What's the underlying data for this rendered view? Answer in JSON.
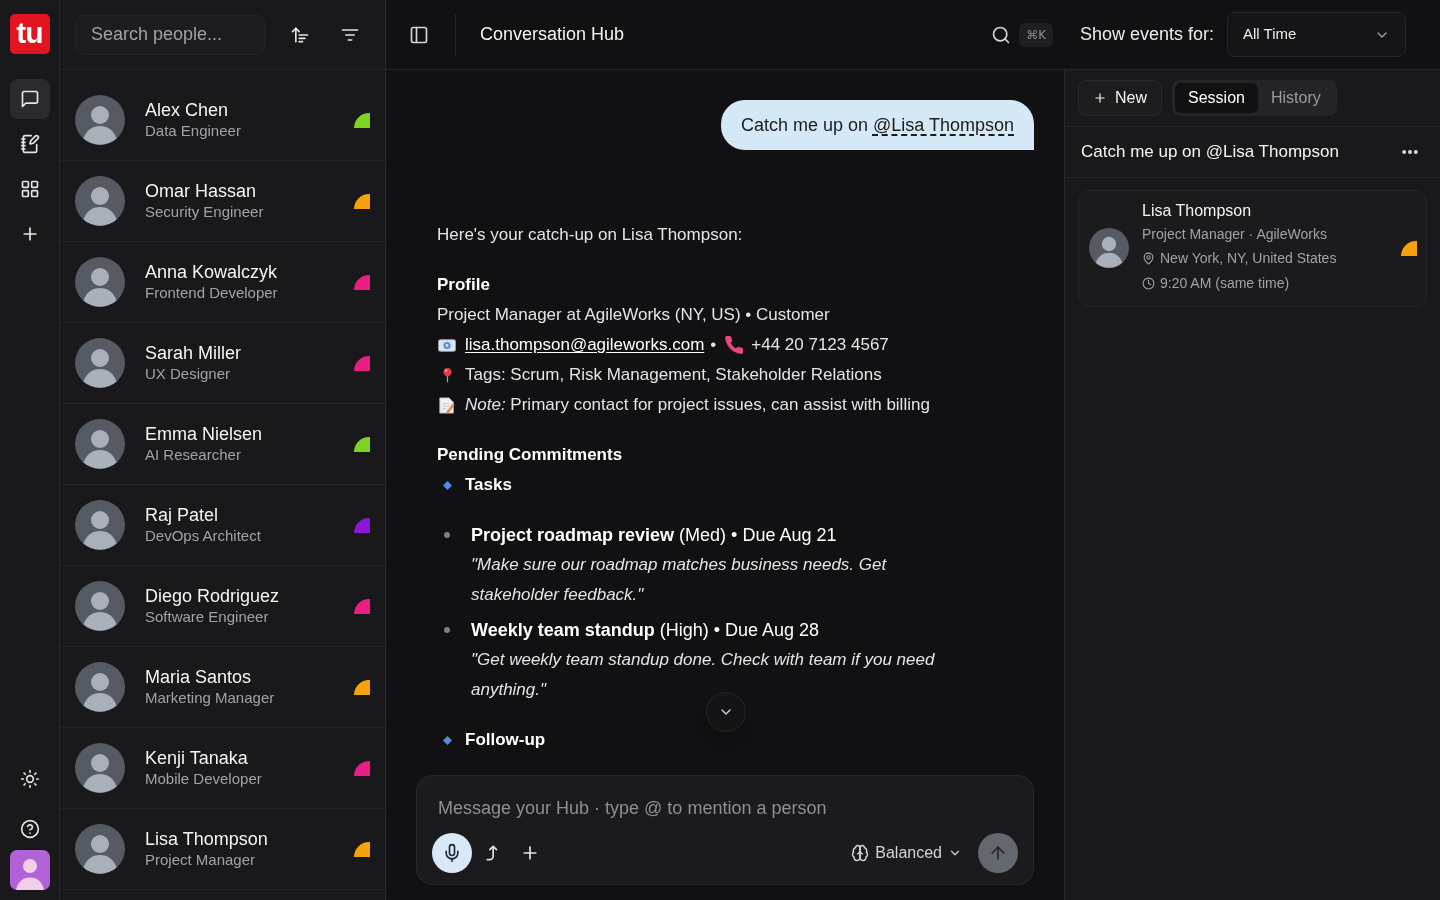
{
  "rail": {
    "logo": "tu",
    "nav": [
      {
        "kind": "chat",
        "selected": true
      },
      {
        "kind": "notes",
        "selected": false
      },
      {
        "kind": "apps",
        "selected": false
      },
      {
        "kind": "add",
        "selected": false
      }
    ]
  },
  "contacts": {
    "search": {
      "placeholder": "Search people..."
    },
    "people": [
      {
        "name": "Alex Chen",
        "role": "Data Engineer",
        "color": "#7dd31f"
      },
      {
        "name": "Omar Hassan",
        "role": "Security Engineer",
        "color": "#f7a10b"
      },
      {
        "name": "Anna Kowalczyk",
        "role": "Frontend Developer",
        "color": "#ea1d84"
      },
      {
        "name": "Sarah Miller",
        "role": "UX Designer",
        "color": "#ea1d84"
      },
      {
        "name": "Emma Nielsen",
        "role": "AI Researcher",
        "color": "#7dd31f"
      },
      {
        "name": "Raj Patel",
        "role": "DevOps Architect",
        "color": "#8a17d9"
      },
      {
        "name": "Diego Rodriguez",
        "role": "Software Engineer",
        "color": "#ea1d84"
      },
      {
        "name": "Maria Santos",
        "role": "Marketing Manager",
        "color": "#f7a10b"
      },
      {
        "name": "Kenji Tanaka",
        "role": "Mobile Developer",
        "color": "#ea1d84"
      },
      {
        "name": "Lisa Thompson",
        "role": "Project Manager",
        "color": "#f7a10b"
      }
    ]
  },
  "header": {
    "title": "Conversation Hub",
    "shortcut": "⌘K",
    "events_label": "Show events for:",
    "events_filter": "All Time"
  },
  "chat": {
    "user_message": {
      "text": "Catch me up on",
      "mention": "@Lisa Thompson"
    },
    "reply": {
      "intro": "Here's your catch-up on Lisa Thompson:",
      "profile": {
        "heading": "Profile",
        "summary": "Project Manager at AgileWorks (NY, US) • Customer",
        "email": "lisa.thompson@agileworks.com",
        "separator": "•",
        "phone": "+44 20 7123 4567",
        "tags": "Tags: Scrum, Risk Management, Stakeholder Relations",
        "note": "*Note:* Primary contact for project issues, can assist with billing"
      },
      "commitments": {
        "heading": "Pending Commitments",
        "groups": [
          {
            "title": "Tasks",
            "items": [
              {
                "title": "**Project roadmap review** (Med) • Due Aug 21",
                "quote": "\"Make sure our roadmap matches business needs. Get stakeholder feedback.\""
              },
              {
                "title": "**Weekly team standup** (High) • Due Aug 28",
                "quote": "\"Get weekly team standup done. Check with team if you need anything.\""
              }
            ]
          },
          {
            "title": "Follow-up"
          }
        ]
      }
    }
  },
  "composer": {
    "placeholder": "Message your Hub · type @ to mention a person",
    "mode": "Balanced"
  },
  "session_panel": {
    "new_button": "New",
    "tabs": [
      {
        "label": "Session",
        "selected": true
      },
      {
        "label": "History",
        "selected": false
      }
    ],
    "session_title": "Catch me up on @Lisa Thompson",
    "card": {
      "name": "Lisa Thompson",
      "subtitle": "Project Manager · AgileWorks",
      "location": "New York, NY, United States",
      "local_time": "9:20 AM (same time)",
      "color": "#f7a10b"
    }
  }
}
